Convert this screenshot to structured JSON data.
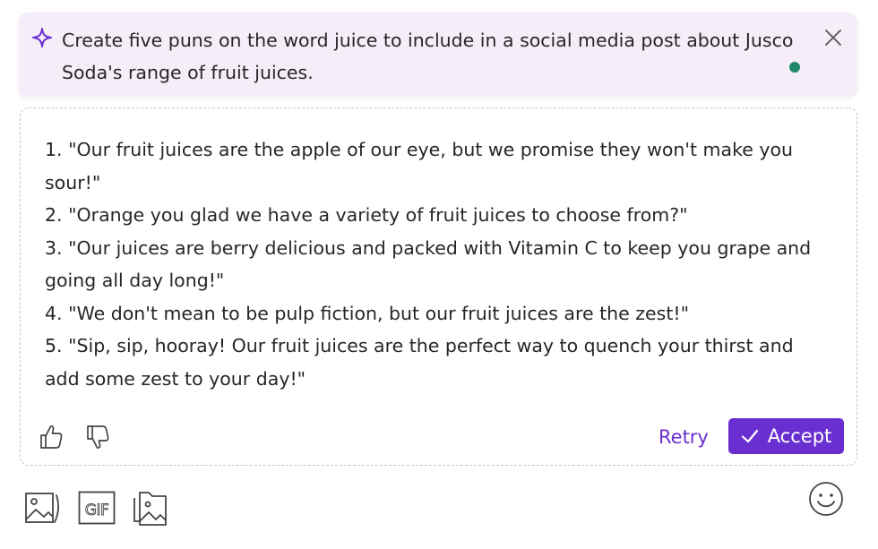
{
  "prompt": {
    "text": "Create five puns on the word juice to include in a social media post about Jusco Soda's range of fruit juices.",
    "icon": "sparkle-icon",
    "close_icon": "close-icon",
    "status_color": "#21876a"
  },
  "response": {
    "items": [
      "1. \"Our fruit juices are the apple of our eye, but we promise they won't make you sour!\"",
      "2. \"Orange you glad we have a variety of fruit juices to choose from?\"",
      "3. \"Our juices are berry delicious and packed with Vitamin C to keep you grape and going all day long!\"",
      "4. \"We don't mean to be pulp fiction, but our fruit juices are the zest!\"",
      "5. \"Sip, sip, hooray! Our fruit juices are the perfect way to quench your thirst and add some zest to your day!\""
    ],
    "retry_label": "Retry",
    "accept_label": "Accept"
  },
  "toolbar": {
    "icons": [
      "image-icon",
      "gif-icon",
      "folder-image-icon",
      "emoji-icon"
    ],
    "gif_label": "GIF"
  },
  "colors": {
    "accent": "#6a2fd0",
    "prompt_background": "#f5eef9",
    "text": "#262626"
  }
}
